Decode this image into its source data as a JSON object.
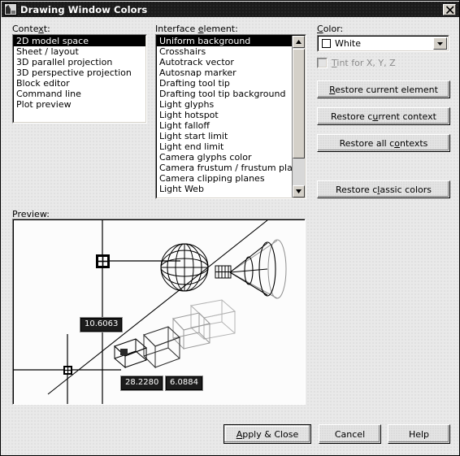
{
  "window": {
    "title": "Drawing Window Colors",
    "icon": "autocad-window-icon",
    "close_label": "×"
  },
  "context": {
    "label": "Context:",
    "accelerator": "x",
    "items": [
      "2D model space",
      "Sheet / layout",
      "3D parallel projection",
      "3D perspective projection",
      "Block editor",
      "Command line",
      "Plot preview"
    ],
    "selected_index": 0
  },
  "interface_element": {
    "label": "Interface element:",
    "accelerator": "e",
    "items": [
      "Uniform background",
      "Crosshairs",
      "Autotrack vector",
      "Autosnap marker",
      "Drafting tool tip",
      "Drafting tool tip background",
      "Light glyphs",
      "Light hotspot",
      "Light falloff",
      "Light start limit",
      "Light end limit",
      "Camera glyphs color",
      "Camera frustum / frustum plane",
      "Camera clipping planes",
      "Light Web"
    ],
    "selected_index": 0,
    "scrollbar": {
      "up_arrow": "▲",
      "down_arrow": "▼"
    }
  },
  "color_panel": {
    "label": "Color:",
    "accelerator": "C",
    "selected_color_name": "White",
    "selected_color_hex": "#ffffff",
    "dropdown_arrow": "▼",
    "tint_checkbox": {
      "label": "Tint for X, Y, Z",
      "accelerator": "T",
      "checked": false,
      "enabled": false
    },
    "buttons": [
      {
        "label": "Restore current element",
        "accelerator": "R"
      },
      {
        "label": "Restore current context",
        "accelerator": "u"
      },
      {
        "label": "Restore all contexts",
        "accelerator": "o"
      },
      {
        "label": "Restore classic colors",
        "accelerator": "l"
      }
    ]
  },
  "preview": {
    "label": "Preview:",
    "tooltips": [
      {
        "text": "10.6063"
      },
      {
        "text": "28.2280"
      },
      {
        "text": "6.0884"
      }
    ],
    "glyphs": [
      "autosnap-marker",
      "crosshairs",
      "autotrack-vector",
      "light-glyph-sphere",
      "camera-frustum-glyph",
      "light-web-glyph"
    ]
  },
  "footer": {
    "buttons": [
      {
        "label": "Apply & Close",
        "accelerator": "A",
        "default": true
      },
      {
        "label": "Cancel",
        "accelerator": "",
        "default": false
      },
      {
        "label": "Help",
        "accelerator": "",
        "default": false
      }
    ]
  }
}
